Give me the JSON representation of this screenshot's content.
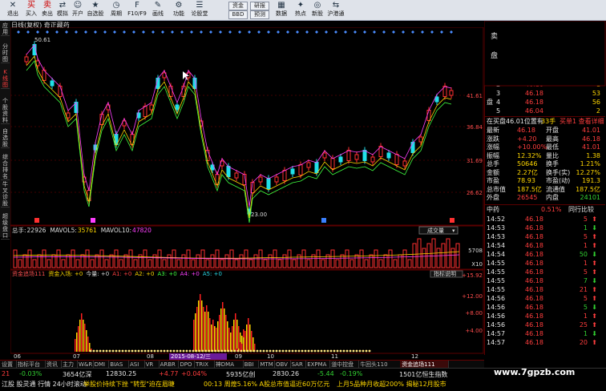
{
  "toolbar": {
    "items": [
      {
        "label": "退出",
        "icon": "exit-icon"
      },
      {
        "label": "买入",
        "icon": "buy-icon"
      },
      {
        "label": "卖出",
        "icon": "sell-icon"
      },
      {
        "label": "模拟",
        "icon": "simulate-icon"
      },
      {
        "label": "开户",
        "icon": "account-icon"
      },
      {
        "label": "自选股",
        "icon": "favorites-icon"
      },
      {
        "label": "周期",
        "icon": "period-icon"
      },
      {
        "label": "F10/F9",
        "icon": "f10-icon"
      },
      {
        "label": "画线",
        "icon": "draw-icon"
      },
      {
        "label": "功能",
        "icon": "function-icon"
      },
      {
        "label": "论股堂",
        "icon": "forum-icon"
      },
      {
        "label": "资讯",
        "icon": "news-icon"
      },
      {
        "label": "数据",
        "icon": "data-icon"
      },
      {
        "label": "热点",
        "icon": "hot-icon"
      },
      {
        "label": "新股",
        "icon": "ipo-icon"
      },
      {
        "label": "沪港通",
        "icon": "hk-connect-icon"
      }
    ],
    "boxes": [
      "资金",
      "研报",
      "BBD",
      "预测"
    ]
  },
  "left_tabs": [
    "应用",
    "分时图",
    "K线图",
    "个股资料",
    "自选股",
    "综合排名",
    "牛叉诊股",
    "超级盘口"
  ],
  "chart": {
    "title": "日线(复权)  奇正藏药",
    "price_labels": [
      "41.61",
      "36.84",
      "31.69",
      "26.62"
    ],
    "high_label": "50.61",
    "low_label": "23.00",
    "volume_info": {
      "label": "总手:",
      "total": "22926",
      "mavol5_label": "MAVOL5:",
      "mavol5": "35761",
      "mavol10_label": "MAVOL10:",
      "mavol10": "47820"
    },
    "volume_selector": "成交量",
    "volume_scale": [
      "5708",
      "X10"
    ],
    "indicator_info": {
      "name": "资金追场111",
      "entry": "资金入场: +0",
      "vol": "今量: +0",
      "a1": "A1: +0",
      "a2": "A2: +0",
      "a3": "A3: +0",
      "a4": "A4: +0",
      "a5": "A5: +0"
    },
    "indicator_help": "指标说明",
    "indicator_scale": [
      "+15.92",
      "+12.00",
      "+8.00",
      "+4.00"
    ],
    "x_labels": [
      "06",
      "07",
      "08",
      "09",
      "10",
      "11",
      "12"
    ],
    "date_label": "2015-08-12/三"
  },
  "tabs": [
    "设置",
    "指标平台",
    "资讯",
    "主力",
    "W&R",
    "DMI",
    "BIAS",
    "ASI",
    "VR",
    "ARBR",
    "DPO",
    "TRIX",
    "神DMA",
    "BBI",
    "MTM",
    "OBV",
    "SAR",
    "EXPMA",
    "道中控盘",
    "牛回头110",
    "资金追场111"
  ],
  "quote": {
    "sell": [
      {
        "n": "卖",
        "lvl": "1",
        "p": "46.18",
        "v": "1"
      },
      {
        "lvl": "2",
        "p": "46.18",
        "v": "1"
      },
      {
        "lvl": "3",
        "p": "46.18",
        "v": "53"
      },
      {
        "n": "盘",
        "lvl": "4",
        "p": "46.18",
        "v": "56"
      },
      {
        "lvl": "5",
        "p": "46.04",
        "v": "2"
      }
    ],
    "inbook": "在买盘46.01位置有",
    "inbook_qty": "33手",
    "inbook_btn": "买单1 查看详细",
    "stats": [
      [
        "最新",
        "46.18",
        "开盘",
        "41.01"
      ],
      [
        "涨跌",
        "+4.20",
        "最高",
        "46.18"
      ],
      [
        "涨幅",
        "+10.00%",
        "最低",
        "41.01"
      ],
      [
        "振幅",
        "12.32%",
        "量比",
        "1.38"
      ],
      [
        "总手",
        "50646",
        "换手",
        "1.21%"
      ],
      [
        "金额",
        "2.27亿",
        "换手(实)",
        "12.27%"
      ],
      [
        "市盈",
        "78.93",
        "市盈(动)",
        "191.3"
      ],
      [
        "总市值",
        "187.5亿",
        "流通值",
        "187.5亿"
      ],
      [
        "外盘",
        "26545",
        "内盘",
        "24101"
      ]
    ],
    "sector": "中药",
    "sector_change": "0.51%",
    "compare": "同行比较",
    "ticks": [
      [
        "14:52",
        "46.18",
        "5"
      ],
      [
        "14:53",
        "46.18",
        "1"
      ],
      [
        "14:53",
        "46.18",
        "5"
      ],
      [
        "14:54",
        "46.18",
        "1"
      ],
      [
        "14:54",
        "46.18",
        "50"
      ],
      [
        "14:55",
        "46.18",
        "1"
      ],
      [
        "14:55",
        "46.18",
        "5"
      ],
      [
        "14:55",
        "46.18",
        "7"
      ],
      [
        "14:55",
        "46.18",
        "21"
      ],
      [
        "14:56",
        "46.18",
        "5"
      ],
      [
        "14:56",
        "46.18",
        "5"
      ],
      [
        "14:56",
        "46.18",
        "1"
      ],
      [
        "14:56",
        "46.18",
        "25"
      ],
      [
        "14:57",
        "46.18",
        "1"
      ],
      [
        "14:57",
        "46.18",
        "20"
      ]
    ]
  },
  "status": {
    "row1": [
      {
        "t": "21",
        "c": "red"
      },
      {
        "t": "-0.03%",
        "c": "grn"
      },
      {
        "t": "3654亿深",
        "c": "wht"
      },
      {
        "t": "12830.25",
        "c": "wht"
      },
      {
        "t": "+4.77",
        "c": "red"
      },
      {
        "t": "+0.04%",
        "c": "red"
      },
      {
        "t": "5935亿创",
        "c": "wht"
      },
      {
        "t": "2830.26",
        "c": "wht"
      },
      {
        "t": "-5.44",
        "c": "grn"
      },
      {
        "t": "-0.19%",
        "c": "grn"
      },
      {
        "t": "1501亿恒生指数",
        "c": "wht"
      }
    ],
    "row2": [
      {
        "t": "江股 股灵通 行情 24小时滚动",
        "c": "wht"
      },
      {
        "t": "举股价持续下挫 \"转型\"迫在眉睫",
        "c": "yel"
      },
      {
        "t": "00:13 周煌5.16% A股总市值逼近60万亿元",
        "c": "yel"
      },
      {
        "t": "上月5品种月收超200% 揭秘12月股市",
        "c": "yel"
      }
    ]
  },
  "watermark": "www.7gpzb.com"
}
